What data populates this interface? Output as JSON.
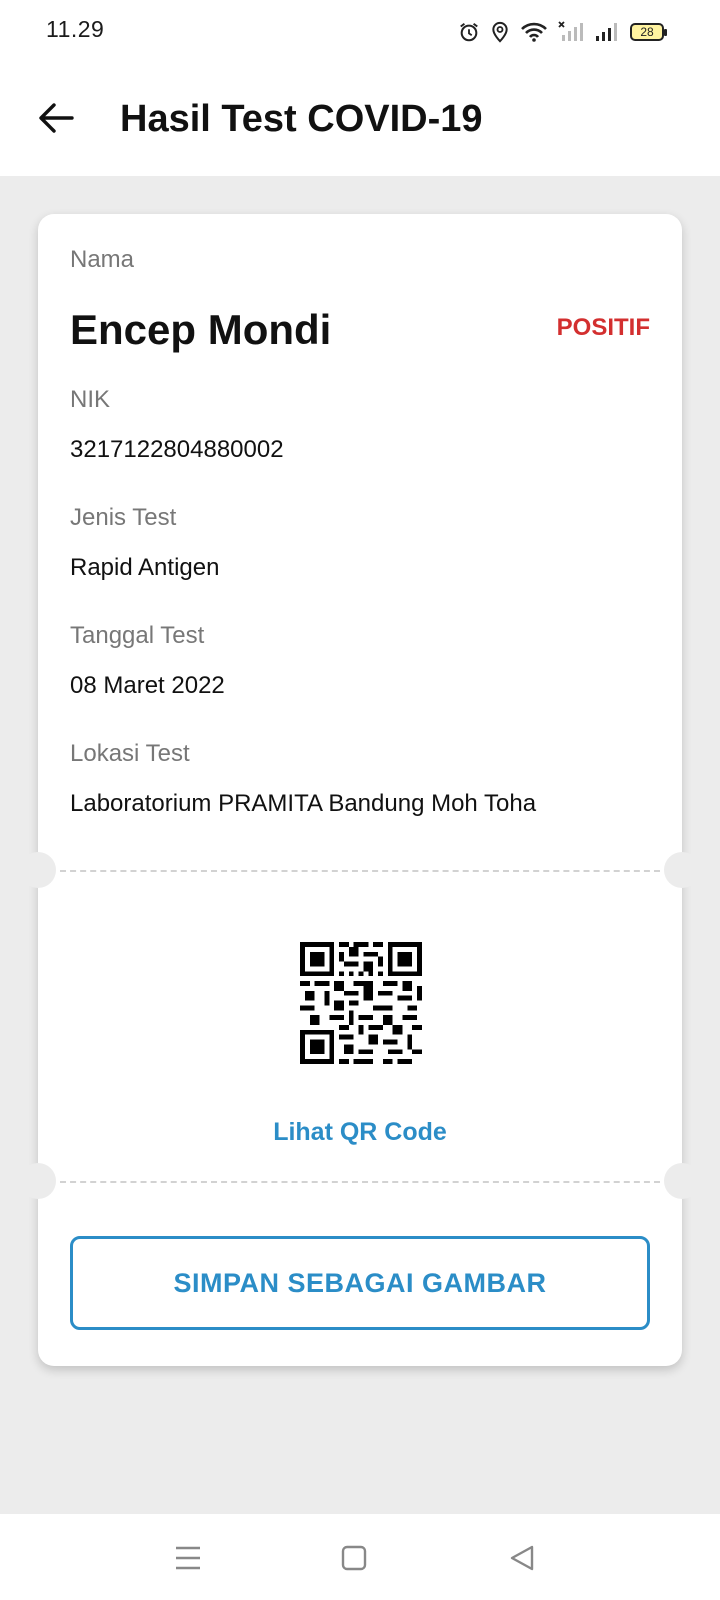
{
  "status_bar": {
    "time": "11.29",
    "battery_level": "28",
    "icons": [
      "alarm-icon",
      "location-icon",
      "wifi-icon",
      "signal-off-icon",
      "signal-icon",
      "battery-icon"
    ]
  },
  "app_bar": {
    "back_icon": "arrow-left-icon",
    "title": "Hasil Test COVID-19"
  },
  "result": {
    "name_label": "Nama",
    "name": "Encep Mondi",
    "status": "POSITIF",
    "status_color": "#d32f2f",
    "nik_label": "NIK",
    "nik": "3217122804880002",
    "test_type_label": "Jenis Test",
    "test_type": "Rapid Antigen",
    "test_date_label": "Tanggal Test",
    "test_date": "08 Maret 2022",
    "test_location_label": "Lokasi Test",
    "test_location": "Laboratorium PRAMITA Bandung Moh Toha"
  },
  "qr": {
    "link_label": "Lihat QR Code"
  },
  "actions": {
    "save_label": "SIMPAN SEBAGAI GAMBAR",
    "accent_color": "#2b8dc7"
  },
  "nav_bar": {
    "items": [
      "menu-icon",
      "home-icon",
      "back-icon"
    ]
  }
}
